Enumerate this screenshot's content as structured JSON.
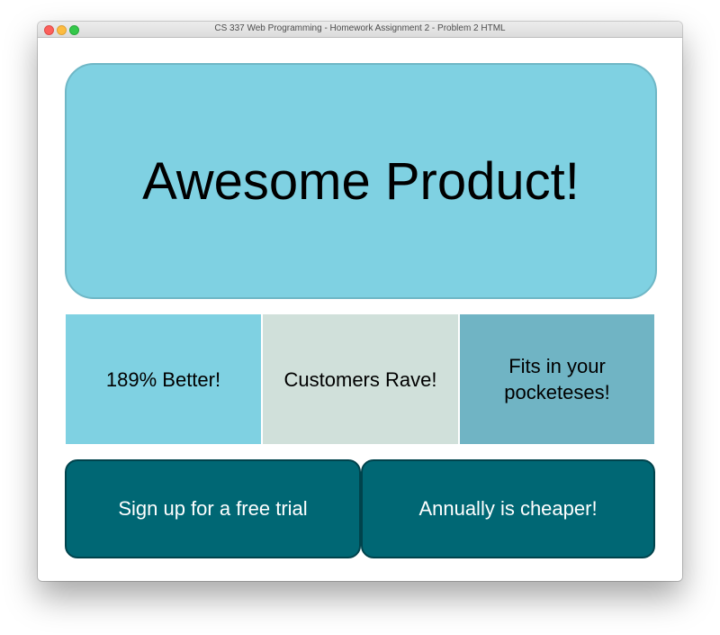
{
  "window": {
    "title": "CS 337 Web Programming - Homework Assignment 2 - Problem 2 HTML"
  },
  "hero": {
    "title": "Awesome Product!"
  },
  "features": [
    {
      "label": "189% Better!"
    },
    {
      "label": "Customers Rave!"
    },
    {
      "label": "Fits in your pocketeses!"
    }
  ],
  "cta": {
    "signup_label": "Sign up for a free trial",
    "annual_label": "Annually is cheaper!"
  },
  "colors": {
    "hero_bg": "#7fd1e2",
    "feature_1_bg": "#7fd1e2",
    "feature_2_bg": "#d0e0da",
    "feature_3_bg": "#70b4c4",
    "cta_bg": "#006774"
  }
}
